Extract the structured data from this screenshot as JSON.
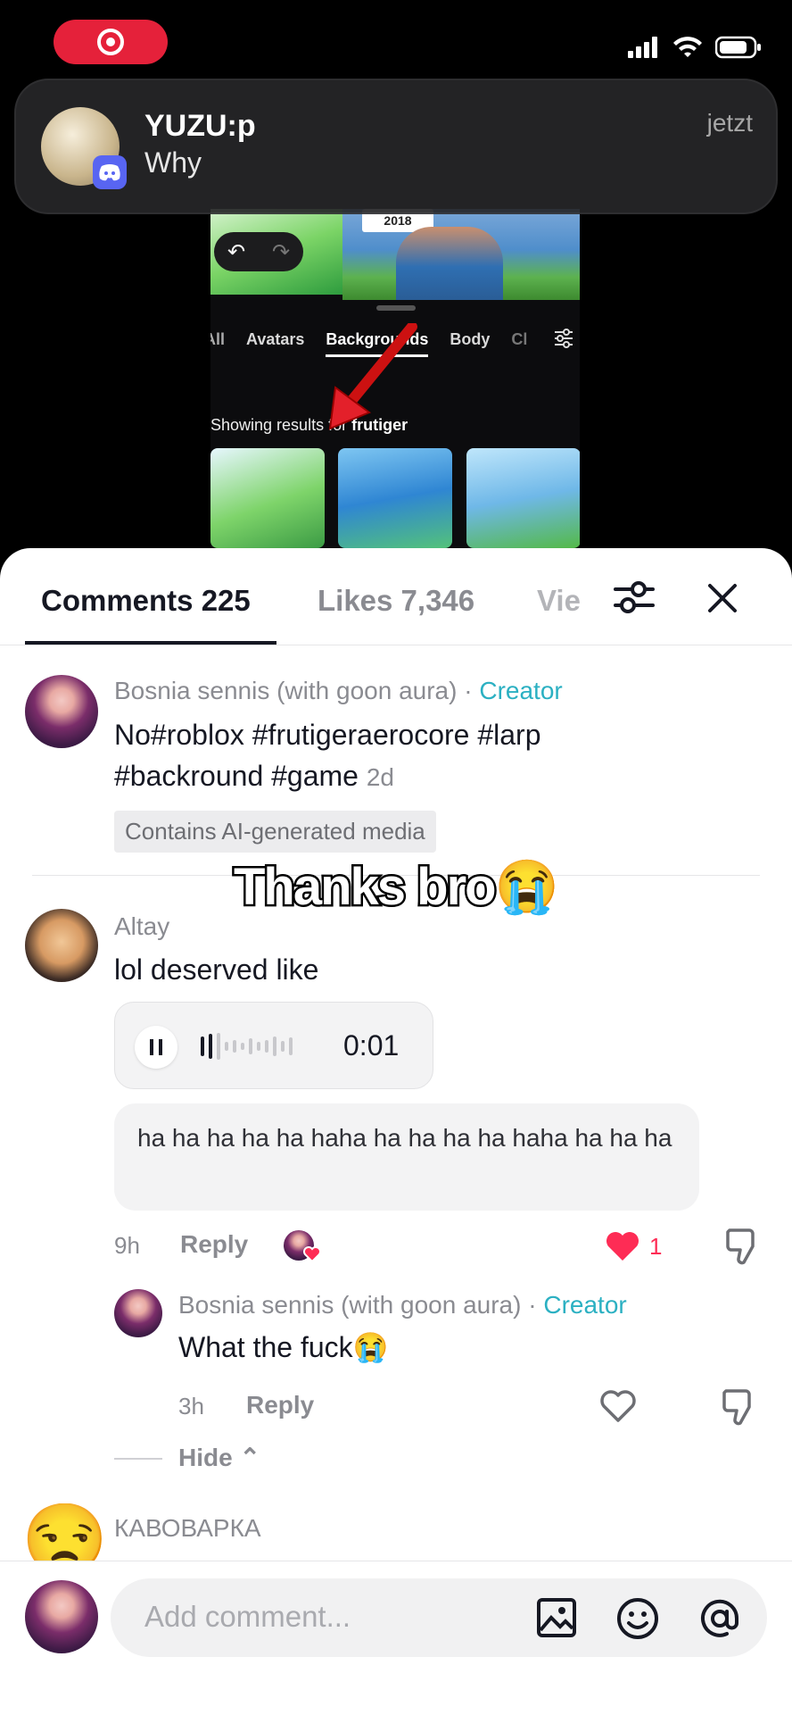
{
  "status_bar": {
    "record_icon": "screen-record-icon",
    "signal_icon": "signal-icon",
    "wifi_icon": "wifi-icon",
    "battery_icon": "battery-icon"
  },
  "notification": {
    "sender": "YUZU:p",
    "message": "Why",
    "time": "jetzt",
    "app_badge_icon": "discord-icon"
  },
  "video": {
    "tabs": [
      "All",
      "Avatars",
      "Backgrounds",
      "Body",
      "Cl"
    ],
    "active_tab": "Backgrounds",
    "results_prefix": "Showing results for",
    "results_query": "frutiger",
    "sign_text": "2018",
    "colors": {
      "thumb_green": "#7bd466",
      "arrow_red": "#e3202a"
    }
  },
  "tabs": {
    "comments": "Comments 225",
    "likes": "Likes 7,346",
    "views": "Vie"
  },
  "caption": {
    "username": "Bosnia sennis (with goon aura)",
    "separator": "·",
    "creator_label": "Creator",
    "text": "No#roblox #frutigeraerocore #larp #backround #game",
    "age": "2d",
    "ai_badge": "Contains AI-generated media"
  },
  "overlay_text": "Thanks bro😭",
  "comment1": {
    "username": "Altay",
    "text": "lol deserved like",
    "voice_time": "0:01",
    "bubble_text": "ha ha ha ha ha haha ha ha ha ha haha ha ha ha",
    "age": "9h",
    "reply_label": "Reply",
    "like_count": "1",
    "colors": {
      "heart": "#fe2c55"
    }
  },
  "reply1": {
    "username": "Bosnia sennis (with goon aura)",
    "separator": "·",
    "creator_label": "Creator",
    "text": "What the fuck😭",
    "age": "3h",
    "reply_label": "Reply"
  },
  "hide_label": "Hide",
  "comment2": {
    "username": "КАВОВАРКА",
    "avatar_emoji": "😒"
  },
  "composer": {
    "placeholder": "Add comment...",
    "image_icon": "image-icon",
    "emoji_icon": "emoji-icon",
    "mention_icon": "at-icon"
  },
  "colors": {
    "creator": "#2bb0c2",
    "primary_text": "#161823",
    "muted_text": "#8a8b91",
    "record_red": "#e5213a",
    "discord": "#5865f2"
  }
}
